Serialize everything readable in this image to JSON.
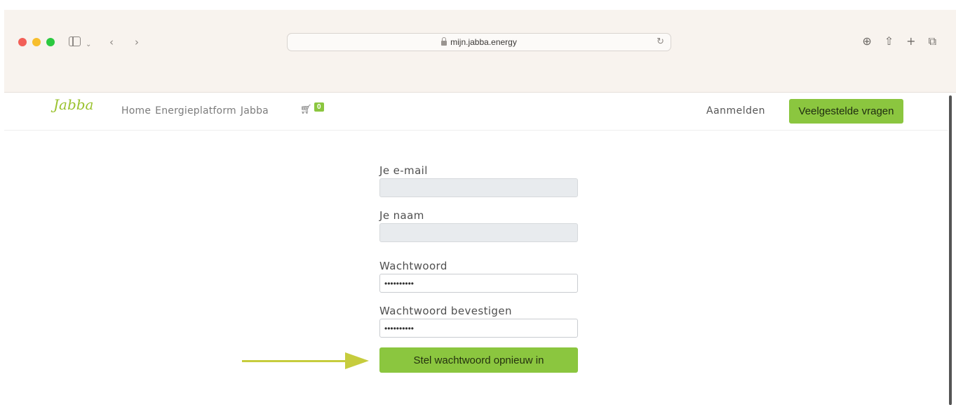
{
  "browser": {
    "url": "mijn.jabba.energy"
  },
  "header": {
    "logo_text": "Jabba",
    "nav": [
      {
        "label": "Home"
      },
      {
        "label": "Energieplatform"
      },
      {
        "label": "Jabba"
      }
    ],
    "cart_count": "0",
    "login_label": "Aanmelden",
    "faq_label": "Veelgestelde vragen"
  },
  "form": {
    "email_label": "Je e-mail",
    "email_value": "",
    "name_label": "Je naam",
    "name_value": "",
    "password_label": "Wachtwoord",
    "password_value": "••••••••••",
    "confirm_label": "Wachtwoord bevestigen",
    "confirm_value": "••••••••••",
    "submit_label": "Stel wachtwoord opnieuw in"
  },
  "colors": {
    "accent": "#8bc63f",
    "arrow": "#c6cc3d"
  }
}
